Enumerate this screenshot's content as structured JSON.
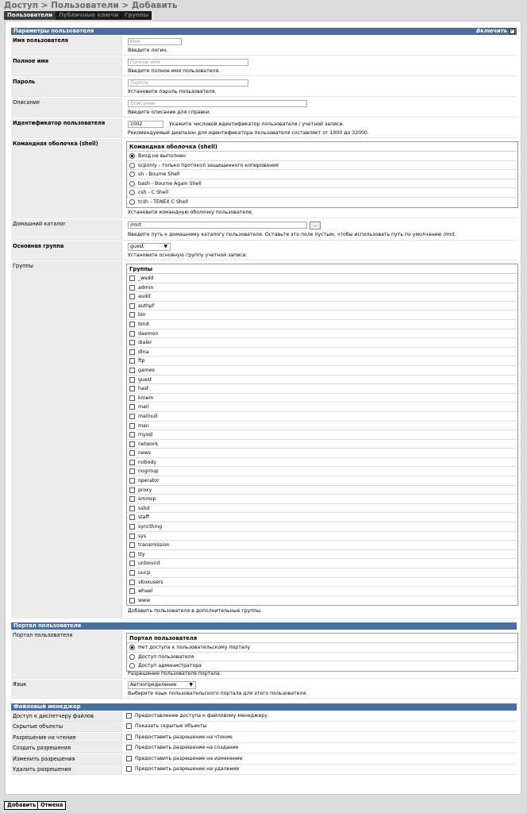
{
  "breadcrumb": "Доступ > Пользователи > Добавить",
  "tabs": [
    "Пользователи",
    "Публичные ключи",
    "Группы"
  ],
  "section_user": {
    "title": "Параметры пользователя",
    "enable_label": "Включить",
    "enabled": true
  },
  "fields": {
    "login": {
      "label": "Имя пользователя",
      "placeholder": "Имя",
      "hint": "Введите логин."
    },
    "fullname": {
      "label": "Полное имя",
      "placeholder": "Полное имя",
      "hint": "Введите полное имя пользователя."
    },
    "password": {
      "label": "Пароль",
      "placeholder": "Пароль",
      "hint": "Установите пароль пользователя."
    },
    "description": {
      "label": "Описание",
      "placeholder": "Описание",
      "hint": "Введите описание для справки."
    },
    "uid": {
      "label": "Идентификатор пользователя",
      "value": "1002",
      "hint_inline": "Укажите числовой идентификатор пользователя / учетной записи.",
      "hint": "Рекомендуемый диапазон для идентификатора пользователя составляет от 1000 до 32000."
    },
    "shell": {
      "label": "Командная оболочка (shell)",
      "box_title": "Командная оболочка (shell)",
      "options": [
        "Вход не выполнен",
        "scponly - только протокол защищенного копирования",
        "sh - Bourne Shell",
        "bash - Bourne Again Shell",
        "csh - C Shell",
        "tcsh - TENEX C Shell"
      ],
      "selected": 0,
      "hint": "Установите командную оболочку пользователя."
    },
    "home": {
      "label": "Домашний каталог",
      "value": "/mnt",
      "browse_label": "...",
      "hint": "Введите путь к домашнему каталогу пользователя. Оставьте это поле пустым, чтобы использовать путь по умолчанию /mnt."
    },
    "primary_group": {
      "label": "Основная группа",
      "value": "guest",
      "hint": "Установите основную группу учетной записи."
    },
    "groups": {
      "label": "Группы",
      "box_title": "Группы",
      "items": [
        "_wsdd",
        "admin",
        "audit",
        "authpf",
        "bin",
        "bind",
        "daemon",
        "dialer",
        "dlna",
        "ftp",
        "games",
        "guest",
        "hast",
        "kmem",
        "mail",
        "mailnull",
        "man",
        "mysql",
        "network",
        "news",
        "nobody",
        "nogroup",
        "operator",
        "proxy",
        "smmsp",
        "sshd",
        "staff",
        "syncthing",
        "sys",
        "transmission",
        "tty",
        "unbound",
        "uucp",
        "vboxusers",
        "wheel",
        "www"
      ],
      "hint": "Добавить пользователя в дополнительные группы."
    }
  },
  "section_portal": {
    "title": "Портал пользователя",
    "portal": {
      "label": "Портал пользователя",
      "box_title": "Портал пользователя",
      "options": [
        "Нет доступа к пользовательскому порталу",
        "Доступ пользователя",
        "Доступ администратора"
      ],
      "selected": 0,
      "hint": "Разрешение пользователя портала."
    },
    "language": {
      "label": "Язык",
      "value": "Автоопределение",
      "hint": "Выберите язык пользовательского портала для этого пользователя."
    }
  },
  "section_fm": {
    "title": "Файловый менеджер",
    "rows": [
      {
        "label": "Доступ к диспетчеру файлов",
        "text": "Предоставление доступа к файловому менеджеру."
      },
      {
        "label": "Скрытые объекты",
        "text": "Показать скрытые объекты"
      },
      {
        "label": "Разрешение на чтение",
        "text": "Предоставить разрешение на чтение"
      },
      {
        "label": "Создать разрешения",
        "text": "Предоставить разрешение на создание"
      },
      {
        "label": "Изменить разрешения",
        "text": "Предоставить разрешение на изменение"
      },
      {
        "label": "Удалить разрешения",
        "text": "Предоставить разрешение на удаление"
      }
    ]
  },
  "buttons": {
    "add": "Добавить",
    "cancel": "Отмена"
  }
}
